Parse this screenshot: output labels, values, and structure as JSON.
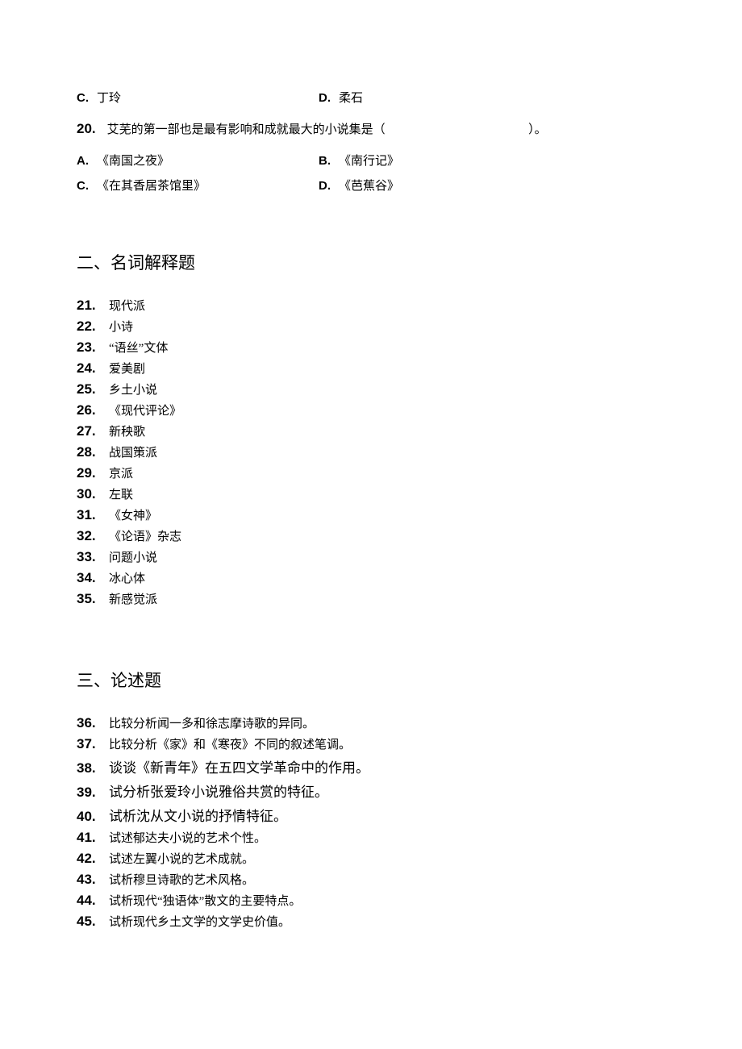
{
  "q19_choices": {
    "c": {
      "letter": "C.",
      "text": "丁玲"
    },
    "d": {
      "letter": "D.",
      "text": "柔石"
    }
  },
  "q20": {
    "num": "20.",
    "stem": "艾芜的第一部也是最有影响和成就最大的小说集是（",
    "closing": "）。",
    "choices": {
      "a": {
        "letter": "A.",
        "text": "《南国之夜》"
      },
      "b": {
        "letter": "B.",
        "text": "《南行记》"
      },
      "c": {
        "letter": "C.",
        "text": "《在其香居茶馆里》"
      },
      "d": {
        "letter": "D.",
        "text": "《芭蕉谷》"
      }
    }
  },
  "section2": {
    "title": "二、名词解释题",
    "items": [
      {
        "num": "21.",
        "text": "现代派"
      },
      {
        "num": "22.",
        "text": "小诗"
      },
      {
        "num": "23.",
        "text": "“语丝”文体"
      },
      {
        "num": "24.",
        "text": "爱美剧"
      },
      {
        "num": "25.",
        "text": "乡土小说"
      },
      {
        "num": "26.",
        "text": "《现代评论》"
      },
      {
        "num": "27.",
        "text": "新秧歌"
      },
      {
        "num": "28.",
        "text": "战国策派"
      },
      {
        "num": "29.",
        "text": "京派"
      },
      {
        "num": "30.",
        "text": "左联"
      },
      {
        "num": "31.",
        "text": "《女神》"
      },
      {
        "num": "32.",
        "text": "《论语》杂志"
      },
      {
        "num": "33.",
        "text": "问题小说"
      },
      {
        "num": "34.",
        "text": "冰心体"
      },
      {
        "num": "35.",
        "text": "新感觉派"
      }
    ]
  },
  "section3": {
    "title": "三、论述题",
    "items": [
      {
        "num": "36.",
        "text": "比较分析闻一多和徐志摩诗歌的异同。",
        "larger": false
      },
      {
        "num": "37.",
        "text": "比较分析《家》和《寒夜》不同的叙述笔调。",
        "larger": false
      },
      {
        "num": "38.",
        "text": "谈谈《新青年》在五四文学革命中的作用。",
        "larger": true
      },
      {
        "num": "39.",
        "text": "试分析张爱玲小说雅俗共赏的特征。",
        "larger": true
      },
      {
        "num": "40.",
        "text": "试析沈从文小说的抒情特征。",
        "larger": true
      },
      {
        "num": "41.",
        "text": "试述郁达夫小说的艺术个性。",
        "larger": false
      },
      {
        "num": "42.",
        "text": "试述左翼小说的艺术成就。",
        "larger": false
      },
      {
        "num": "43.",
        "text": "试析穆旦诗歌的艺术风格。",
        "larger": false
      },
      {
        "num": "44.",
        "text": "试析现代“独语体”散文的主要特点。",
        "larger": false
      },
      {
        "num": "45.",
        "text": "试析现代乡土文学的文学史价值。",
        "larger": false
      }
    ]
  }
}
